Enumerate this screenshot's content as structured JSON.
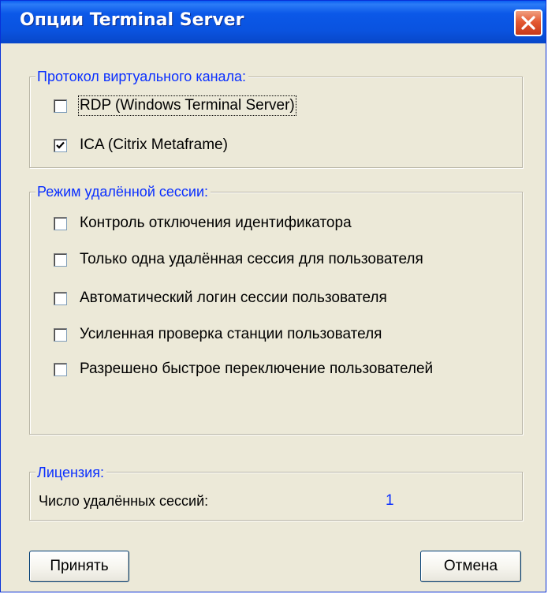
{
  "window": {
    "title": "Опции Terminal Server",
    "close_icon": "close-icon"
  },
  "protocol_group": {
    "legend": "Протокол виртуального канала:",
    "options": [
      {
        "label": "RDP (Windows Terminal Server)",
        "checked": false,
        "focused": true
      },
      {
        "label": "ICA   (Citrix Metaframe)",
        "checked": true,
        "focused": false
      }
    ]
  },
  "session_group": {
    "legend": "Режим удалённой сессии:",
    "options": [
      {
        "label": "Контроль отключения идентификатора",
        "checked": false
      },
      {
        "label": "Только одна удалённая сессия для пользователя",
        "checked": false
      },
      {
        "label": "Автоматический логин сессии пользователя",
        "checked": false
      },
      {
        "label": "Усиленная проверка станции пользователя",
        "checked": false
      },
      {
        "label": "Разрешено быстрое переключение пользователей",
        "checked": false
      }
    ]
  },
  "license_group": {
    "legend": "Лицензия:",
    "sessions_label": "Число удалённых сессий:",
    "sessions_value": "1"
  },
  "buttons": {
    "accept_label": "Принять",
    "cancel_label": "Отмена"
  },
  "colors": {
    "titlebar": "#0a53df",
    "legend_text": "#0a2fff",
    "dialog_bg": "#ece9d8",
    "close_button": "#e45a33"
  }
}
